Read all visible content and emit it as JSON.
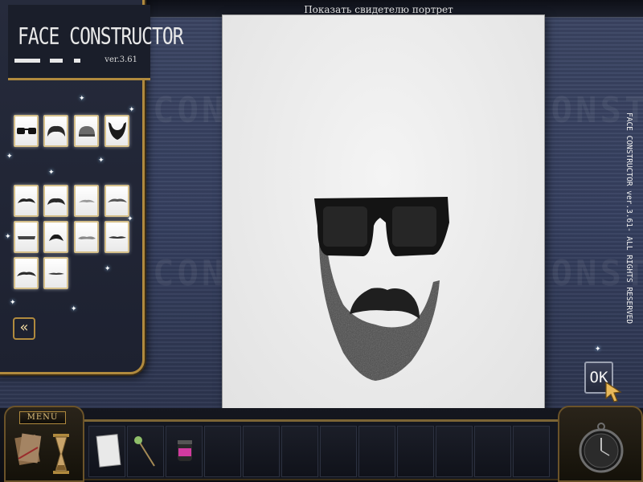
{
  "app": {
    "title": "FACE CONSTRUCTOR",
    "version": "ver.3.61",
    "side_text": "FACE CONSTRUCTOR ver.3.61- ALL RIGHTS RESERVED"
  },
  "paper": {
    "caption": "Показать свидетелю портрет"
  },
  "buttons": {
    "ok_label": "OK",
    "menu_label": "MENU",
    "back_label": "«"
  },
  "watermark": {
    "text": "CONSTRUCTOR"
  },
  "features": {
    "row1": [
      {
        "icon": "sunglasses-icon"
      },
      {
        "icon": "hair-icon"
      },
      {
        "icon": "cap-icon"
      },
      {
        "icon": "beard-icon"
      }
    ],
    "mustaches": [
      {
        "icon": "mustache-1-icon"
      },
      {
        "icon": "mustache-2-icon"
      },
      {
        "icon": "mustache-3-icon"
      },
      {
        "icon": "mustache-4-icon"
      },
      {
        "icon": "mustache-5-icon"
      },
      {
        "icon": "mustache-6-icon"
      },
      {
        "icon": "mustache-7-icon"
      },
      {
        "icon": "mustache-8-icon"
      },
      {
        "icon": "mustache-9-icon"
      },
      {
        "icon": "mustache-10-icon"
      }
    ]
  },
  "inventory": {
    "items": [
      {
        "icon": "paper-sheet-icon"
      },
      {
        "icon": "flower-icon"
      },
      {
        "icon": "jar-icon"
      }
    ]
  },
  "colors": {
    "panel_border": "#b08a3e",
    "background": "#364060",
    "paper": "#eeeeee"
  }
}
